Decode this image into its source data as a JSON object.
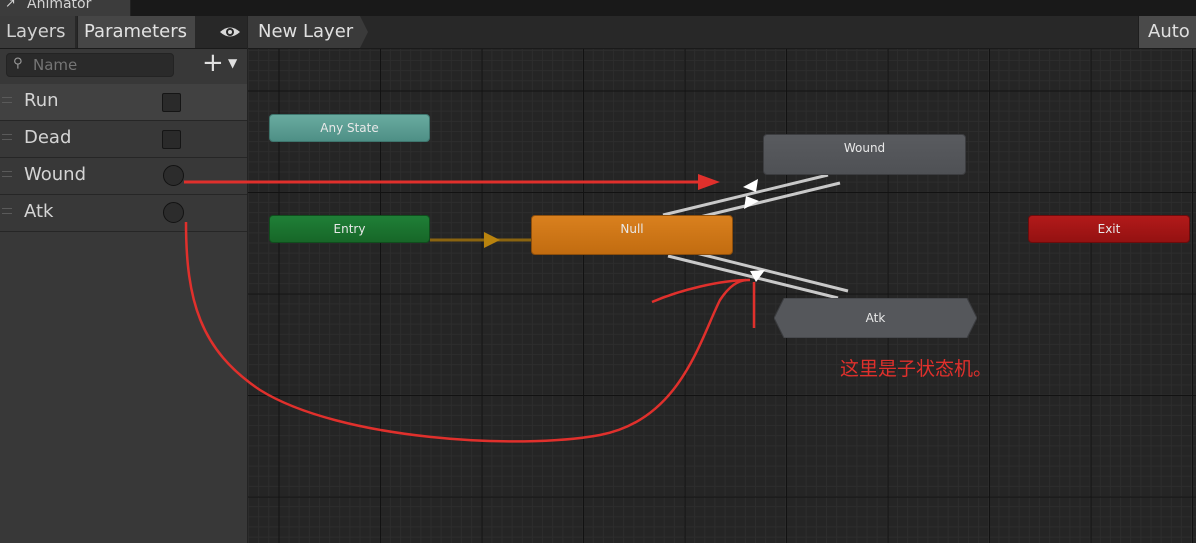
{
  "window": {
    "title": "Animator"
  },
  "left_panel": {
    "tabs": [
      {
        "label": "Layers"
      },
      {
        "label": "Parameters"
      }
    ],
    "search": {
      "placeholder": "Name",
      "value": ""
    },
    "parameters": [
      {
        "name": "Run",
        "type": "bool"
      },
      {
        "name": "Dead",
        "type": "bool"
      },
      {
        "name": "Wound",
        "type": "trigger"
      },
      {
        "name": "Atk",
        "type": "trigger"
      }
    ]
  },
  "graph": {
    "breadcrumb": "New Layer",
    "auto_button": "Auto L",
    "nodes": {
      "any_state": "Any State",
      "entry": "Entry",
      "null": "Null",
      "wound": "Wound",
      "atk": "Atk",
      "exit": "Exit"
    },
    "annotation": "这里是子状态机。"
  },
  "colors": {
    "any_state": "#5f9e95",
    "entry": "#1c7431",
    "default_state": "#d07718",
    "state": "#55575b",
    "exit": "#a31616",
    "annotation_red": "#e0302c"
  }
}
